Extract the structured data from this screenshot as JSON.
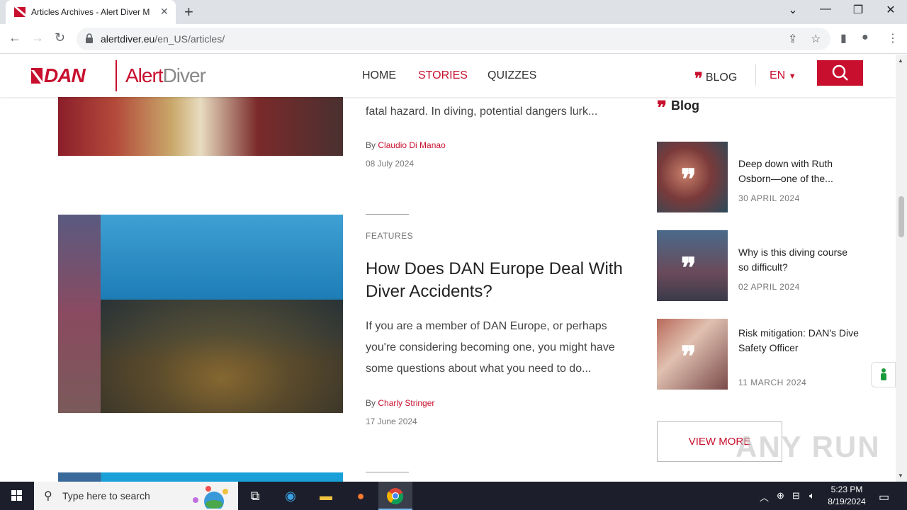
{
  "browser": {
    "tab_title": "Articles Archives - Alert Diver M",
    "url_host": "alertdiver.eu",
    "url_path": "/en_US/articles/"
  },
  "site": {
    "logo_dan": "DAN",
    "logo_alert": "Alert",
    "logo_diver": "Diver",
    "nav": [
      "HOME",
      "STORIES",
      "QUIZZES"
    ],
    "active_nav": "STORIES",
    "blog_label": "BLOG",
    "lang": "EN",
    "accent_color": "#c8102e"
  },
  "articles": [
    {
      "excerpt_tail": "fatal hazard. In diving, potential dangers lurk...",
      "by": "By",
      "author": "Claudio Di Manao",
      "date": "08 July 2024"
    },
    {
      "category": "FEATURES",
      "title": "How Does DAN Europe Deal With Diver Accidents?",
      "excerpt": "If you are a member of DAN Europe, or perhaps you're considering becoming one, you might have some questions about what you need to do...",
      "by": "By",
      "author": "Charly Stringer",
      "date": "17 June 2024"
    }
  ],
  "sidebar": {
    "heading": "Blog",
    "posts": [
      {
        "title": "Deep down with Ruth Osborn—one of the...",
        "date": "30 APRIL 2024"
      },
      {
        "title": "Why is this diving course so difficult?",
        "date": "02 APRIL 2024"
      },
      {
        "title": "Risk mitigation: DAN's Dive Safety Officer",
        "date": "11 MARCH 2024"
      }
    ],
    "view_more": "VIEW MORE"
  },
  "watermark": "ANY RUN",
  "taskbar": {
    "search_placeholder": "Type here to search",
    "time": "5:23 PM",
    "date": "8/19/2024"
  }
}
